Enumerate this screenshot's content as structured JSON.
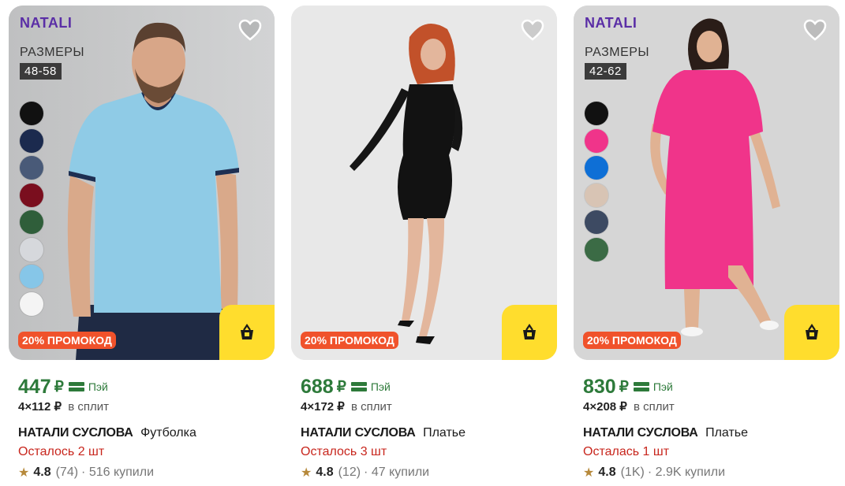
{
  "cards": [
    {
      "brand": "NATALI",
      "sizes_label": "РАЗМЕРЫ",
      "sizes_range": "48-58",
      "swatches": [
        "#111111",
        "#1b2a4e",
        "#495a78",
        "#7a0e1e",
        "#2f5e3a",
        "#d6d8dc",
        "#86c6e8",
        "#f4f4f4"
      ],
      "promo": "20% ПРОМОКОД",
      "price": "447",
      "currency": "₽",
      "pay_label": "Пэй",
      "split_amount": "4×112 ₽",
      "split_text": "в сплит",
      "seller": "НАТАЛИ СУСЛОВА",
      "product": "Футболка",
      "stock": "Осталось 2 шт",
      "rating": "4.8",
      "reviews": "(74)",
      "bought": "· 516 купили",
      "icons": {
        "favorite": "heart-icon",
        "cart": "basket-icon",
        "star": "star-icon",
        "pay": "card-icon"
      }
    },
    {
      "brand": "",
      "sizes_label": "",
      "sizes_range": "",
      "swatches": [],
      "promo": "20% ПРОМОКОД",
      "price": "688",
      "currency": "₽",
      "pay_label": "Пэй",
      "split_amount": "4×172 ₽",
      "split_text": "в сплит",
      "seller": "НАТАЛИ СУСЛОВА",
      "product": "Платье",
      "stock": "Осталось 3 шт",
      "rating": "4.8",
      "reviews": "(12)",
      "bought": "· 47 купили",
      "icons": {
        "favorite": "heart-icon",
        "cart": "basket-icon",
        "star": "star-icon",
        "pay": "card-icon"
      }
    },
    {
      "brand": "NATALI",
      "sizes_label": "РАЗМЕРЫ",
      "sizes_range": "42-62",
      "swatches": [
        "#111111",
        "#f0348a",
        "#0e6fd6",
        "#d8c4b4",
        "#3d4a62",
        "#3b6b45"
      ],
      "promo": "20% ПРОМОКОД",
      "price": "830",
      "currency": "₽",
      "pay_label": "Пэй",
      "split_amount": "4×208 ₽",
      "split_text": "в сплит",
      "seller": "НАТАЛИ СУСЛОВА",
      "product": "Платье",
      "stock": "Осталась 1 шт",
      "rating": "4.8",
      "reviews": "(1K)",
      "bought": "· 2.9K купили",
      "icons": {
        "favorite": "heart-icon",
        "cart": "basket-icon",
        "star": "star-icon",
        "pay": "card-icon"
      }
    }
  ],
  "colors": {
    "price_green": "#2d7a3a",
    "stock_red": "#c8261d",
    "promo_orange": "#f0522b",
    "cart_yellow": "#ffdd2d",
    "brand_purple": "#5a2ea6"
  }
}
